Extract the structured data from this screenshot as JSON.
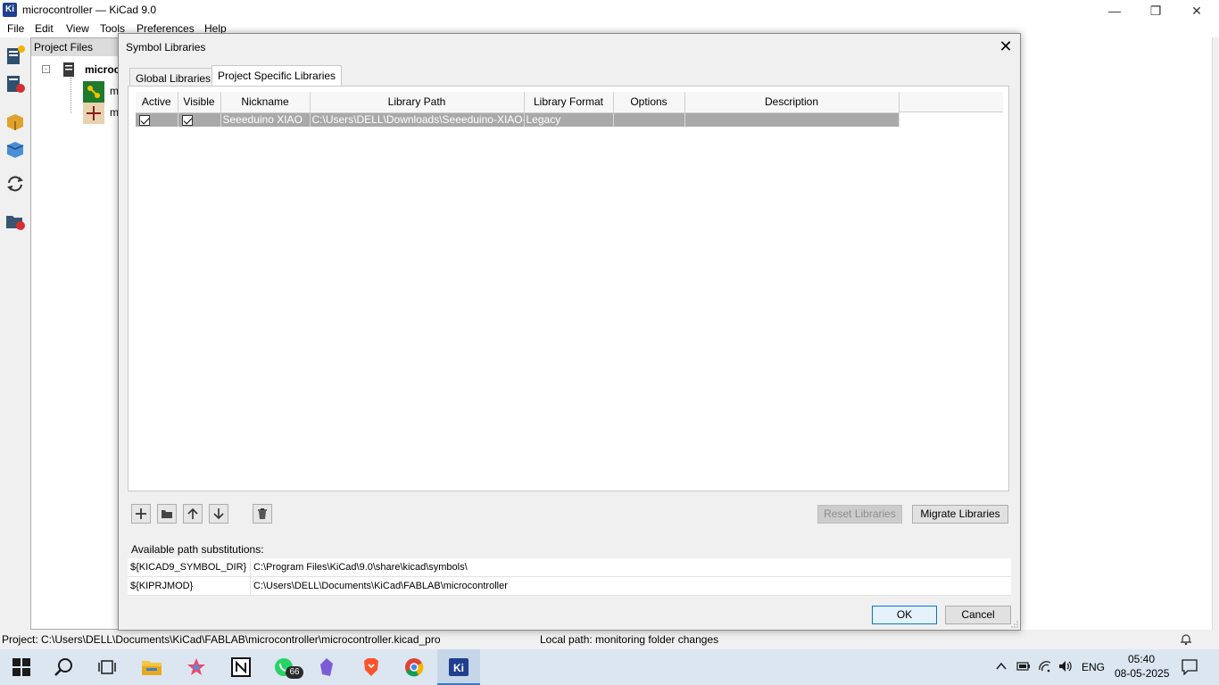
{
  "window": {
    "title": "microcontroller — KiCad 9.0",
    "app_icon": "Ki"
  },
  "menu": [
    "File",
    "Edit",
    "View",
    "Tools",
    "Preferences",
    "Help"
  ],
  "project_panel": {
    "header": "Project Files",
    "root": "microc",
    "child1": "m",
    "child2": "m"
  },
  "dialog": {
    "title": "Symbol Libraries",
    "tabs": [
      "Global Libraries",
      "Project Specific Libraries"
    ],
    "active_tab": "Project Specific Libraries",
    "columns": [
      "Active",
      "Visible",
      "Nickname",
      "Library Path",
      "Library Format",
      "Options",
      "Description"
    ],
    "rows": [
      {
        "active": true,
        "visible": true,
        "nickname": "Seeeduino XIAO",
        "path": "C:\\Users\\DELL\\Downloads\\Seeeduino-XIAO-",
        "format": "Legacy",
        "options": "",
        "description": ""
      }
    ],
    "buttons": {
      "reset": "Reset Libraries",
      "migrate": "Migrate Libraries",
      "ok": "OK",
      "cancel": "Cancel"
    },
    "substitutions_label": "Available path substitutions:",
    "substitutions": [
      {
        "key": "${KICAD9_SYMBOL_DIR}",
        "value": "C:\\Program Files\\KiCad\\9.0\\share\\kicad\\symbols\\"
      },
      {
        "key": "${KIPRJMOD}",
        "value": "C:\\Users\\DELL\\Documents\\KiCad\\FABLAB\\microcontroller"
      }
    ]
  },
  "status": {
    "project": "Project: C:\\Users\\DELL\\Documents\\KiCad\\FABLAB\\microcontroller\\microcontroller.kicad_pro",
    "local": "Local path: monitoring folder changes"
  },
  "taskbar": {
    "whatsapp_badge": "66",
    "language": "ENG",
    "time": "05:40",
    "date": "08-05-2025"
  }
}
